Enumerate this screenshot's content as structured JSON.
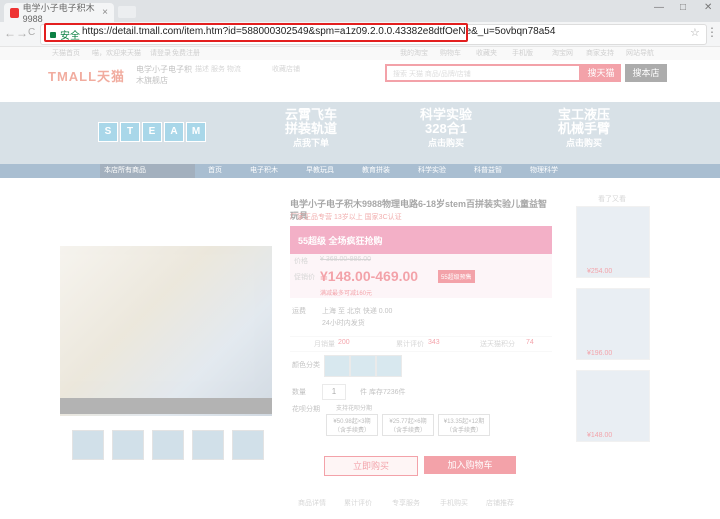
{
  "browser": {
    "tab_title": "电学小子电子积木9988",
    "tab_close": "×",
    "new_tab": "",
    "win_minimize": "—",
    "win_maximize": "□",
    "win_close": "✕",
    "nav_back": "←",
    "nav_forward": "→",
    "nav_reload": "C",
    "secure_label": "安全",
    "url": "https://detail.tmall.com/item.htm?id=588000302549&spm=a1z09.2.0.0.43382e8dtfOeNe&_u=5ovbqn78a54",
    "bookmark_icon": "☆",
    "menu_icon": "⋮"
  },
  "page": {
    "topbar": [
      "天猫首页",
      "喵，欢迎来天猫",
      "请登录",
      "免费注册",
      "我的淘宝",
      "购物车",
      "收藏夹",
      "手机版",
      "淘宝网",
      "商家支持",
      "网站导航"
    ],
    "logo": "TMALL天猫",
    "shop_name": "电学小子电子积木旗舰店",
    "shop_note": "描述 服务 物流",
    "favorite": "收藏店铺",
    "search_placeholder": "搜索 天猫 商品/品牌/店铺",
    "search_button": "搜天猫",
    "shop_search_button": "搜本店",
    "banner": {
      "steam": [
        "S",
        "T",
        "E",
        "A",
        "M"
      ],
      "item1_title": "云霄飞车",
      "item1_line2": "拼装轨道",
      "item1_sub": "点我下单",
      "item2_title": "科学实验",
      "item2_line2": "328合1",
      "item2_sub": "点击购买",
      "item3_title": "宝工液压",
      "item3_line2": "机械手臂",
      "item3_sub": "点击购买"
    },
    "categories": {
      "all": "本店所有商品",
      "items": [
        "首页",
        "电子积木",
        "早教玩具",
        "教育拼装",
        "科学实验",
        "科普益智",
        "物理科学"
      ]
    },
    "product": {
      "title": "电学小子电子积木9988物理电路6-18岁stem百拼装实验儿童益智玩具",
      "subtitle": "厂家正品专营 13岁以上 国家3C认证",
      "promo": "55超级 全场疯狂抢购",
      "label_price": "价格",
      "orig_price": "¥ 368.00-986.00",
      "label_promo": "促销价",
      "price": "¥148.00-469.00",
      "badge": "55超级预售",
      "price_note": "满减最多可减160元",
      "label_ship": "运费",
      "ship": "上海 至 北京 快递 0.00",
      "ship_time": "24小时内发货",
      "stat_sales_label": "月销量",
      "stat_sales": "200",
      "stat_reviews_label": "累计评价",
      "stat_reviews": "343",
      "stat_points_label": "送天猫积分",
      "stat_points": "74",
      "label_color": "颜色分类",
      "label_qty": "数量",
      "qty": "1",
      "stock": "件 库存7236件",
      "label_plan": "花呗分期",
      "plan_free": "支持花呗分期",
      "plans": [
        "¥50.98起×3期",
        "¥25.77起×6期",
        "¥13.35起×12期"
      ],
      "plans_sub": "（含手续费）",
      "buy_now": "立即购买",
      "add_cart": "加入购物车"
    },
    "side": {
      "label": "看了又看",
      "prices": [
        "¥254.00",
        "¥196.00",
        "¥148.00"
      ]
    },
    "bottom_links": [
      "商品详情",
      "累计评价",
      "专享服务",
      "手机购买",
      "店铺推荐"
    ]
  }
}
